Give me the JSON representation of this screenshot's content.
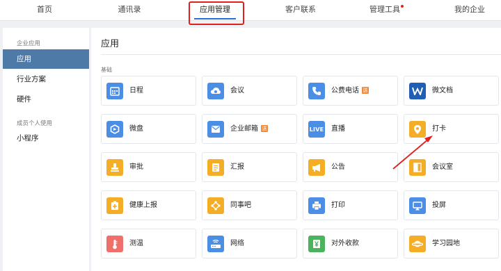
{
  "nav": {
    "items": [
      "首页",
      "通讯录",
      "应用管理",
      "客户联系",
      "管理工具",
      "我的企业"
    ],
    "active_index": 2,
    "highlight_color": "#e02020",
    "accent_color": "#2a6fd6"
  },
  "sidebar": {
    "section1": "企业应用",
    "items1": [
      "应用",
      "行业方案",
      "硬件"
    ],
    "section2": "成员个人使用",
    "items2": [
      "小程序"
    ],
    "active_color": "#4e7aa8"
  },
  "main": {
    "title": "应用",
    "group": "基础",
    "apps": [
      {
        "label": "日程",
        "icon": "calendar-icon",
        "badge": ""
      },
      {
        "label": "会议",
        "icon": "cloud-icon",
        "badge": ""
      },
      {
        "label": "公费电话",
        "icon": "phone-icon",
        "badge": "送"
      },
      {
        "label": "微文档",
        "icon": "doc-w-icon",
        "badge": ""
      },
      {
        "label": "微盘",
        "icon": "drive-icon",
        "badge": ""
      },
      {
        "label": "企业邮箱",
        "icon": "mail-icon",
        "badge": "送"
      },
      {
        "label": "直播",
        "icon": "live-icon",
        "icon_text": "LIVE",
        "badge": ""
      },
      {
        "label": "打卡",
        "icon": "location-pin-icon",
        "badge": ""
      },
      {
        "label": "审批",
        "icon": "stamp-icon",
        "badge": ""
      },
      {
        "label": "汇报",
        "icon": "report-icon",
        "badge": ""
      },
      {
        "label": "公告",
        "icon": "megaphone-icon",
        "badge": ""
      },
      {
        "label": "会议室",
        "icon": "door-icon",
        "badge": ""
      },
      {
        "label": "健康上报",
        "icon": "medical-icon",
        "badge": ""
      },
      {
        "label": "同事吧",
        "icon": "share-icon",
        "badge": ""
      },
      {
        "label": "打印",
        "icon": "printer-icon",
        "badge": ""
      },
      {
        "label": "投屏",
        "icon": "screen-cast-icon",
        "badge": ""
      },
      {
        "label": "测温",
        "icon": "thermometer-icon",
        "badge": ""
      },
      {
        "label": "网络",
        "icon": "router-icon",
        "badge": ""
      },
      {
        "label": "对外收款",
        "icon": "yuan-icon",
        "badge": ""
      },
      {
        "label": "学习园地",
        "icon": "planet-icon",
        "badge": ""
      }
    ]
  },
  "annotation_color": "#e02020"
}
